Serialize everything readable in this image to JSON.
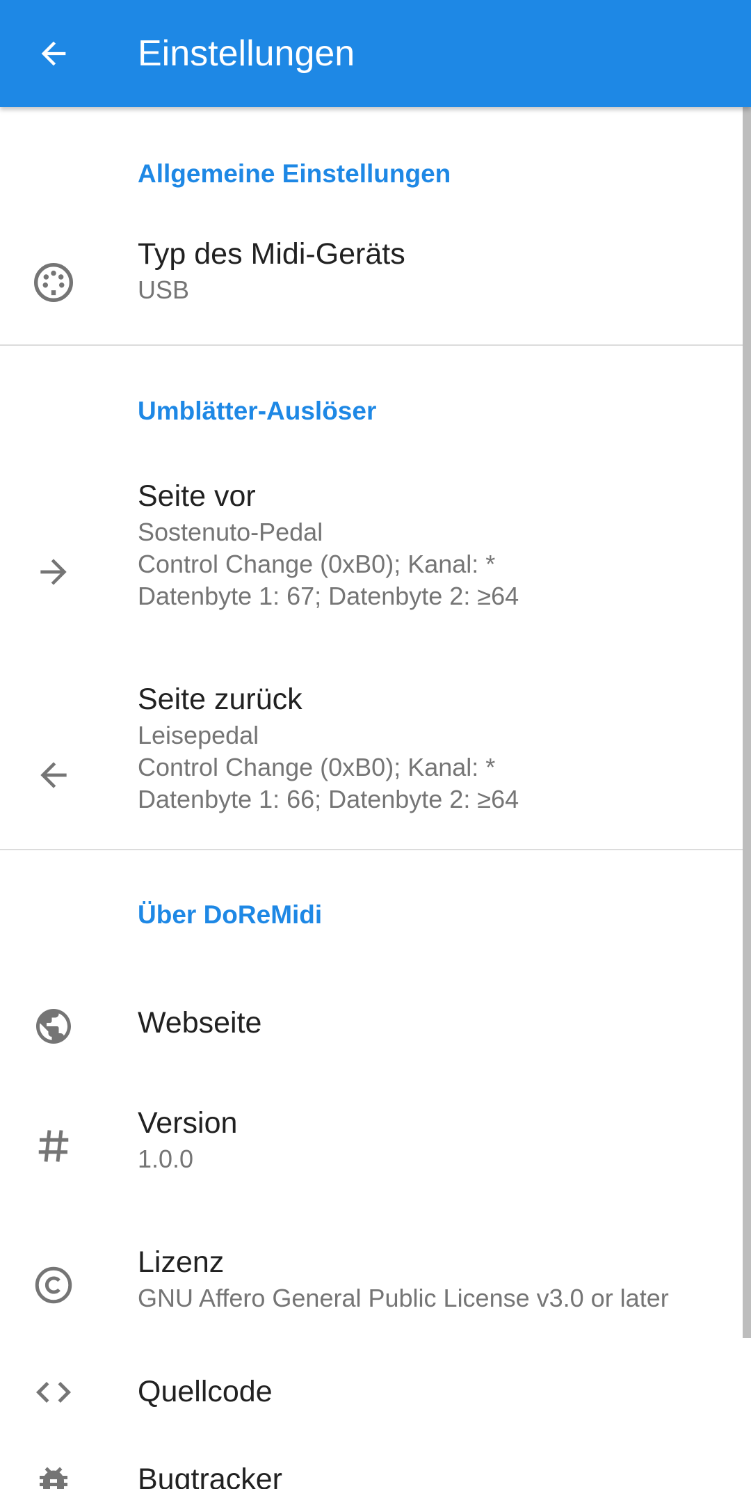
{
  "appbar": {
    "title": "Einstellungen",
    "back_icon": "arrow-back-icon",
    "color": "#1E88E5"
  },
  "sections": {
    "general": {
      "title": "Allgemeine Einstellungen",
      "midi_device": {
        "icon": "midi-connector-icon",
        "title": "Typ des Midi-Geräts",
        "summary": "USB"
      }
    },
    "page_turn": {
      "title": "Umblätter-Auslöser",
      "next": {
        "icon": "arrow-forward-icon",
        "title": "Seite vor",
        "summary_lines": [
          "Sostenuto-Pedal",
          "Control Change (0xB0); Kanal: *",
          "Datenbyte 1: 67; Datenbyte 2: ≥64"
        ]
      },
      "prev": {
        "icon": "arrow-back-icon",
        "title": "Seite zurück",
        "summary_lines": [
          "Leisepedal",
          "Control Change (0xB0); Kanal: *",
          "Datenbyte 1: 66; Datenbyte 2: ≥64"
        ]
      }
    },
    "about": {
      "title": "Über DoReMidi",
      "website": {
        "icon": "globe-icon",
        "title": "Webseite"
      },
      "version": {
        "icon": "hash-icon",
        "title": "Version",
        "summary": "1.0.0"
      },
      "license": {
        "icon": "copyright-icon",
        "title": "Lizenz",
        "summary": "GNU Affero General Public License v3.0 or later"
      },
      "source": {
        "icon": "code-icon",
        "title": "Quellcode"
      },
      "bugtracker": {
        "icon": "bug-icon",
        "title": "Bugtracker"
      }
    }
  },
  "colors": {
    "accent": "#1E88E5",
    "title_text": "#212121",
    "summary_text": "#757575",
    "icon": "#757575"
  }
}
